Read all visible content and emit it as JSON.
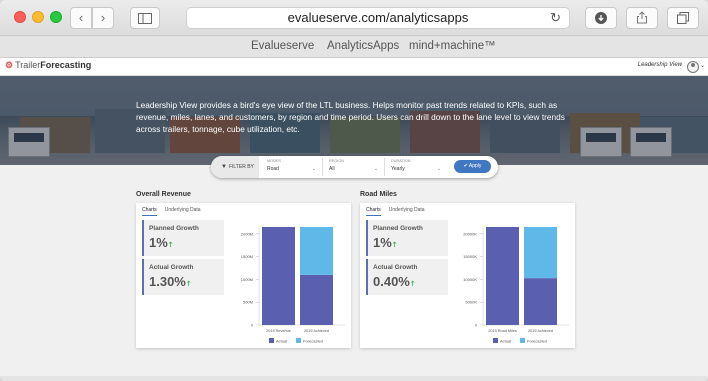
{
  "browser": {
    "address": "evalueserve.com/analyticsapps",
    "favorites": [
      "Evalueserve",
      "AnalyticsApps",
      "mind+machine™"
    ]
  },
  "app": {
    "logo_prefix": "Trailer",
    "logo_suffix": "Forecasting",
    "view_label": "Leadership View"
  },
  "hero": {
    "text": "Leadership View provides a bird's eye view of the LTL business. Helps monitor past trends related to KPIs, such as revenue, miles, lanes, and customers, by region and time period. Users can drill down to the lane level to view trends across trailers, tonnage, cube utilization, etc."
  },
  "filter": {
    "label": "FILTER BY",
    "groups": [
      {
        "label": "MODES",
        "value": "Road"
      },
      {
        "label": "REGION",
        "value": "All"
      },
      {
        "label": "DURATION",
        "value": "Yearly"
      }
    ],
    "apply_label": "Apply"
  },
  "colors": {
    "actual": "#5b5fb0",
    "forecasted": "#5fb8e8",
    "growth_arrow": "#2eaa4a",
    "apply": "#3f78c0"
  },
  "panels": [
    {
      "title": "Overall Revenue",
      "tabs": [
        "Charts",
        "Underlying Data"
      ],
      "kpis": [
        {
          "label": "Planned Growth",
          "value": "1%"
        },
        {
          "label": "Actual Growth",
          "value": "1.30%"
        }
      ],
      "chart_data": {
        "type": "bar",
        "stacked": true,
        "categories": [
          "2019 Revenue",
          "2019 Achieved"
        ],
        "series": [
          {
            "name": "Actual",
            "values": [
              2150,
              1100
            ]
          },
          {
            "name": "Forecasted",
            "values": [
              0,
              1050
            ]
          }
        ],
        "yticks": [
          "0",
          "500M",
          "1000M",
          "1500M",
          "2000M"
        ],
        "ylim": [
          0,
          2150
        ],
        "legend": "bottom"
      }
    },
    {
      "title": "Road Miles",
      "tabs": [
        "Charts",
        "Underlying Data"
      ],
      "kpis": [
        {
          "label": "Planned Growth",
          "value": "1%"
        },
        {
          "label": "Actual Growth",
          "value": "0.40%"
        }
      ],
      "chart_data": {
        "type": "bar",
        "stacked": true,
        "categories": [
          "2019 Road Miles",
          "2019 Achieved"
        ],
        "series": [
          {
            "name": "Actual",
            "values": [
              23000,
              11000
            ]
          },
          {
            "name": "Forecasted",
            "values": [
              0,
              12000
            ]
          }
        ],
        "yticks": [
          "0",
          "5000K",
          "10000K",
          "15000K",
          "20000K"
        ],
        "ylim": [
          0,
          23000
        ],
        "legend": "bottom"
      }
    }
  ]
}
